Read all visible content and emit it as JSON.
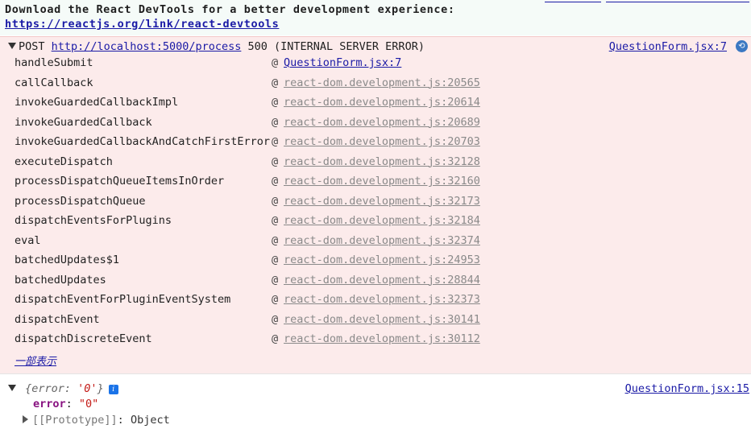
{
  "banner": {
    "line1": "Download the React DevTools for a better development experience:",
    "link": "https://reactjs.org/link/react-devtools"
  },
  "error": {
    "method": "POST",
    "url": "http://localhost:5000/process",
    "status": "500 (INTERNAL SERVER ERROR)",
    "source": "QuestionForm.jsx:7",
    "icon": "network-request-icon",
    "at": "@",
    "frames": [
      {
        "fn": "handleSubmit",
        "loc": "QuestionForm.jsx:7"
      },
      {
        "fn": "callCallback",
        "loc": "react-dom.development.js:20565"
      },
      {
        "fn": "invokeGuardedCallbackImpl",
        "loc": "react-dom.development.js:20614"
      },
      {
        "fn": "invokeGuardedCallback",
        "loc": "react-dom.development.js:20689"
      },
      {
        "fn": "invokeGuardedCallbackAndCatchFirstError",
        "loc": "react-dom.development.js:20703"
      },
      {
        "fn": "executeDispatch",
        "loc": "react-dom.development.js:32128"
      },
      {
        "fn": "processDispatchQueueItemsInOrder",
        "loc": "react-dom.development.js:32160"
      },
      {
        "fn": "processDispatchQueue",
        "loc": "react-dom.development.js:32173"
      },
      {
        "fn": "dispatchEventsForPlugins",
        "loc": "react-dom.development.js:32184"
      },
      {
        "fn": "eval",
        "loc": "react-dom.development.js:32374"
      },
      {
        "fn": "batchedUpdates$1",
        "loc": "react-dom.development.js:24953"
      },
      {
        "fn": "batchedUpdates",
        "loc": "react-dom.development.js:28844"
      },
      {
        "fn": "dispatchEventForPluginEventSystem",
        "loc": "react-dom.development.js:32373"
      },
      {
        "fn": "dispatchEvent",
        "loc": "react-dom.development.js:30141"
      },
      {
        "fn": "dispatchDiscreteEvent",
        "loc": "react-dom.development.js:30112"
      }
    ],
    "show_less": "一部表示"
  },
  "log_object": {
    "preview_open": "{error: ",
    "preview_value": "'0'",
    "preview_close": "}",
    "badge": "i",
    "source": "QuestionForm.jsx:15",
    "prop_key": "error",
    "prop_sep": ": ",
    "prop_value": "\"0\"",
    "proto_key": "[[Prototype]]",
    "proto_sep": ": ",
    "proto_value": "Object"
  }
}
